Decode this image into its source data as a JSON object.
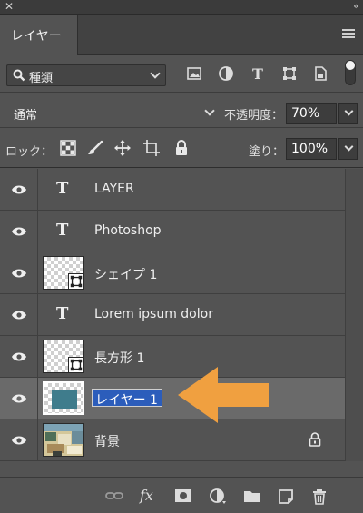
{
  "panel": {
    "tab_label": "レイヤー"
  },
  "filter": {
    "label": "種類"
  },
  "blend": {
    "mode": "通常",
    "opacity_label": "不透明度：",
    "opacity_value": "70%"
  },
  "lock": {
    "label": "ロック：",
    "fill_label": "塗り：",
    "fill_value": "100%"
  },
  "layers": [
    {
      "name": "LAYER",
      "type": "text"
    },
    {
      "name": "Photoshop",
      "type": "text"
    },
    {
      "name": "シェイプ 1",
      "type": "shape"
    },
    {
      "name": "Lorem ipsum dolor",
      "type": "text"
    },
    {
      "name": "長方形 1",
      "type": "shape"
    },
    {
      "name": "レイヤー 1",
      "type": "pixel",
      "selected": true,
      "editing": true
    },
    {
      "name": "背景",
      "type": "background",
      "locked": true
    }
  ],
  "colors": {
    "panel": "#535353",
    "selection": "#2c5dbb",
    "arrow": "#f0a040",
    "layer_fill": "#3f7c8c"
  },
  "icons": {
    "filter": [
      "image-icon",
      "adjustment-icon",
      "type-icon",
      "shape-icon",
      "smart-object-icon"
    ],
    "lock": [
      "lock-transparent-icon",
      "lock-paint-icon",
      "lock-position-icon",
      "lock-artboard-icon",
      "lock-all-icon"
    ],
    "bottom": [
      "link-icon",
      "fx-icon",
      "mask-icon",
      "adjustment-layer-icon",
      "group-folder-icon",
      "new-layer-icon",
      "trash-icon"
    ]
  }
}
